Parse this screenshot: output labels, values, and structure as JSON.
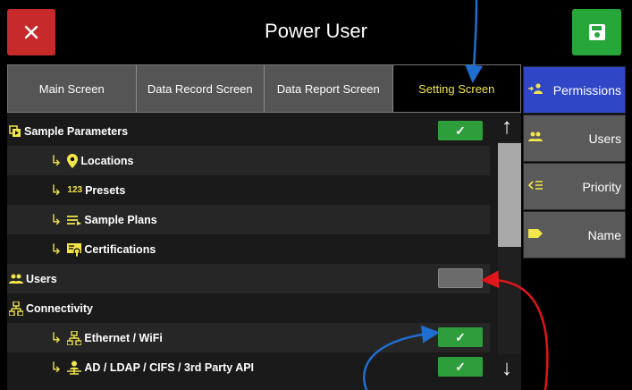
{
  "header": {
    "title": "Power User",
    "close_icon": "close-icon",
    "save_icon": "save-icon"
  },
  "tabs": [
    {
      "label": "Main Screen",
      "active": false
    },
    {
      "label": "Data Record Screen",
      "active": false
    },
    {
      "label": "Data Report Screen",
      "active": false
    },
    {
      "label": "Setting Screen",
      "active": true
    }
  ],
  "rows": [
    {
      "label": "Sample Parameters",
      "icon": "sample-parameters-icon",
      "sub": false,
      "toggle": "on"
    },
    {
      "label": "Locations",
      "icon": "location-pin-icon",
      "sub": true,
      "toggle": null
    },
    {
      "label": "Presets",
      "icon": "presets-icon",
      "glyph": "123",
      "sub": true,
      "toggle": null
    },
    {
      "label": "Sample Plans",
      "icon": "sample-plans-icon",
      "sub": true,
      "toggle": null
    },
    {
      "label": "Certifications",
      "icon": "certifications-icon",
      "sub": true,
      "toggle": null
    },
    {
      "label": "Users",
      "icon": "users-icon",
      "sub": false,
      "toggle": "off"
    },
    {
      "label": "Connectivity",
      "icon": "network-icon",
      "sub": false,
      "toggle": null
    },
    {
      "label": "Ethernet / WiFi",
      "icon": "network-icon",
      "sub": true,
      "toggle": "on"
    },
    {
      "label": "AD / LDAP / CIFS / 3rd Party API",
      "icon": "api-user-icon",
      "sub": true,
      "toggle": "on"
    }
  ],
  "side_buttons": [
    {
      "label": "Permissions",
      "icon": "permissions-icon",
      "active": true
    },
    {
      "label": "Users",
      "icon": "users-icon",
      "active": false
    },
    {
      "label": "Priority",
      "icon": "priority-icon",
      "active": false
    },
    {
      "label": "Name",
      "icon": "tag-icon",
      "active": false
    }
  ],
  "colors": {
    "accent": "#f2e64a",
    "close": "#c62a2a",
    "save": "#27a63a",
    "active_side": "#2f46c7",
    "toggle_on": "#2e9d3c",
    "annotation_blue": "#1f6fd0",
    "annotation_red": "#e0161b"
  }
}
